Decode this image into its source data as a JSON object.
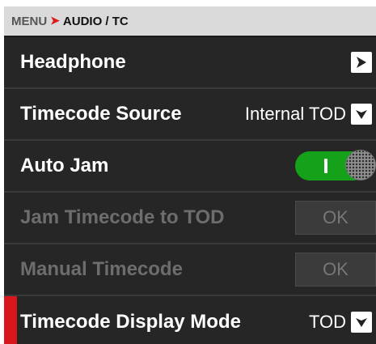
{
  "header": {
    "root": "MENU",
    "separator": "➤",
    "current": "AUDIO / TC"
  },
  "rows": [
    {
      "label": "Headphone",
      "control": "submenu-arrow",
      "enabled": true
    },
    {
      "label": "Timecode Source",
      "control": "dropdown",
      "value": "Internal TOD",
      "enabled": true
    },
    {
      "label": "Auto Jam",
      "control": "toggle",
      "state": "on",
      "enabled": true
    },
    {
      "label": "Jam Timecode to TOD",
      "control": "button",
      "button_label": "OK",
      "enabled": false
    },
    {
      "label": "Manual Timecode",
      "control": "button",
      "button_label": "OK",
      "enabled": false
    },
    {
      "label": "Timecode Display Mode",
      "control": "dropdown",
      "value": "TOD",
      "enabled": true,
      "selected_marker": true
    }
  ],
  "colors": {
    "background": "#262626",
    "header_bg": "#dadada",
    "toggle_on": "#15a21a",
    "selection_marker": "#d9161c",
    "disabled_text": "#6d6d6d"
  },
  "icons": {
    "submenu": "chevron-right-icon",
    "dropdown": "chevron-down-icon"
  }
}
